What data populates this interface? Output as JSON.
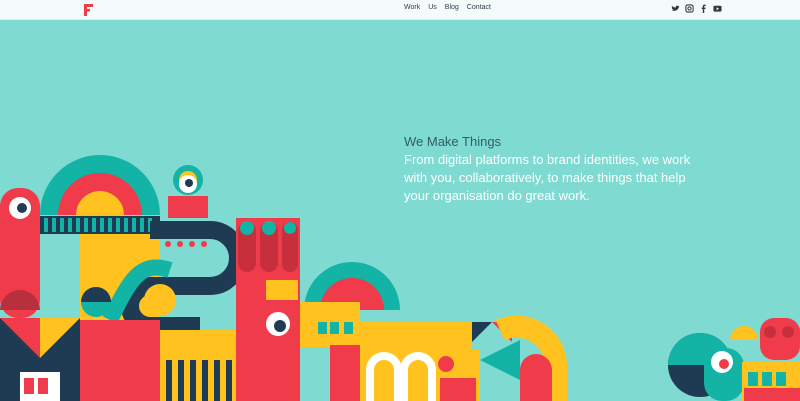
{
  "brand": {
    "logo_text": "F",
    "logo_color": "#ef3b4a"
  },
  "nav": {
    "items": [
      {
        "label": "Work"
      },
      {
        "label": "Us"
      },
      {
        "label": "Blog"
      },
      {
        "label": "Contact"
      }
    ]
  },
  "social": {
    "icons": [
      "twitter-icon",
      "instagram-icon",
      "facebook-icon",
      "youtube-icon"
    ]
  },
  "hero": {
    "title": "We Make Things",
    "body": "From digital platforms to brand identities, we work with you, collaboratively, to make things that help your organisation do great work."
  },
  "colors": {
    "background": "#7fdad2",
    "red": "#ef3b4a",
    "yellow": "#ffc21f",
    "teal": "#13b3a6",
    "navy": "#1f3b53",
    "white": "#ffffff"
  }
}
